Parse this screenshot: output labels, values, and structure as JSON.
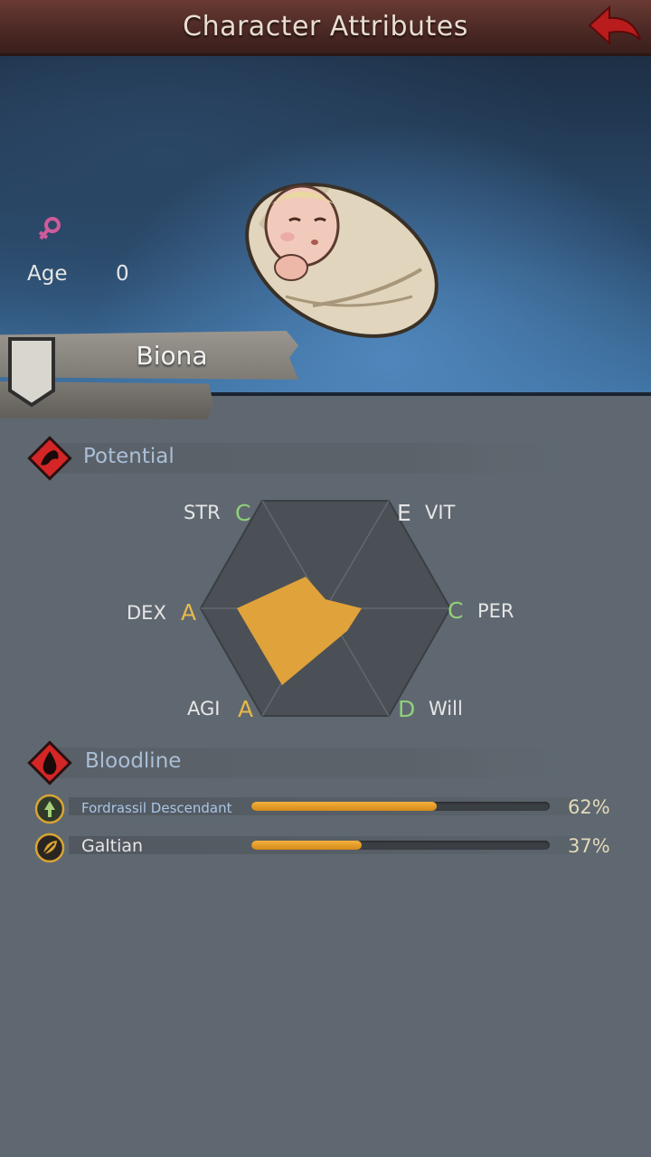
{
  "header": {
    "title": "Character Attributes"
  },
  "character": {
    "name": "Biona",
    "gender_icon": "female-icon",
    "age_label": "Age",
    "age_value": "0"
  },
  "potential": {
    "label": "Potential",
    "stats": [
      {
        "key": "STR",
        "grade": "C"
      },
      {
        "key": "VIT",
        "grade": "E"
      },
      {
        "key": "PER",
        "grade": "C"
      },
      {
        "key": "Will",
        "grade": "D"
      },
      {
        "key": "AGI",
        "grade": "A"
      },
      {
        "key": "DEX",
        "grade": "A"
      }
    ]
  },
  "bloodline": {
    "label": "Bloodline",
    "items": [
      {
        "name": "Fordrassil Descendant",
        "percent": "62%",
        "fraction": 0.62,
        "icon": "tree-icon"
      },
      {
        "name": "Galtian",
        "percent": "37%",
        "fraction": 0.37,
        "icon": "leaf-icon"
      }
    ]
  },
  "colors": {
    "radar_fill": "#e0a23a",
    "grade_green": "#8fd07a",
    "grade_yellow": "#e8b84a",
    "title_bar": "#4a2824"
  }
}
